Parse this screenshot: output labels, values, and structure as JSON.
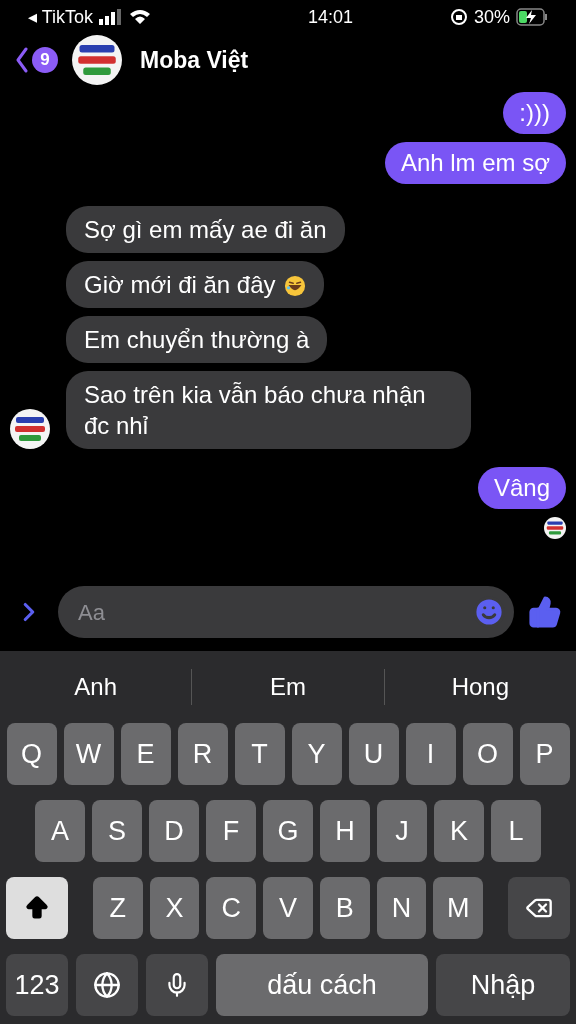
{
  "status_bar": {
    "back_arrow": "◂",
    "back_app": "TikTok",
    "time": "14:01",
    "battery": "30%"
  },
  "header": {
    "unread": "9",
    "name": "Moba Việt"
  },
  "messages": [
    {
      "kind": "sent",
      "text": ":)))"
    },
    {
      "kind": "sent",
      "text": "Anh lm em sợ"
    },
    {
      "kind": "received",
      "text": "Sợ gì em mấy ae đi ăn"
    },
    {
      "kind": "received",
      "text": "Giờ mới đi ăn đây",
      "emoji": true
    },
    {
      "kind": "received",
      "text": "Em chuyển thường à"
    },
    {
      "kind": "received",
      "text": "Sao trên kia vẫn báo chưa nhận đc nhỉ",
      "avatar": true
    },
    {
      "kind": "sent",
      "text": "Vâng",
      "seen": true
    }
  ],
  "composer": {
    "placeholder": "Aa"
  },
  "keyboard": {
    "suggestions": [
      "Anh",
      "Em",
      "Hong"
    ],
    "rows": [
      [
        "Q",
        "W",
        "E",
        "R",
        "T",
        "Y",
        "U",
        "I",
        "O",
        "P"
      ],
      [
        "A",
        "S",
        "D",
        "F",
        "G",
        "H",
        "J",
        "K",
        "L"
      ],
      [
        "Z",
        "X",
        "C",
        "V",
        "B",
        "N",
        "M"
      ]
    ],
    "shift_on": true,
    "numbers_key": "123",
    "space_key": "dấu cách",
    "return_key": "Nhập"
  }
}
